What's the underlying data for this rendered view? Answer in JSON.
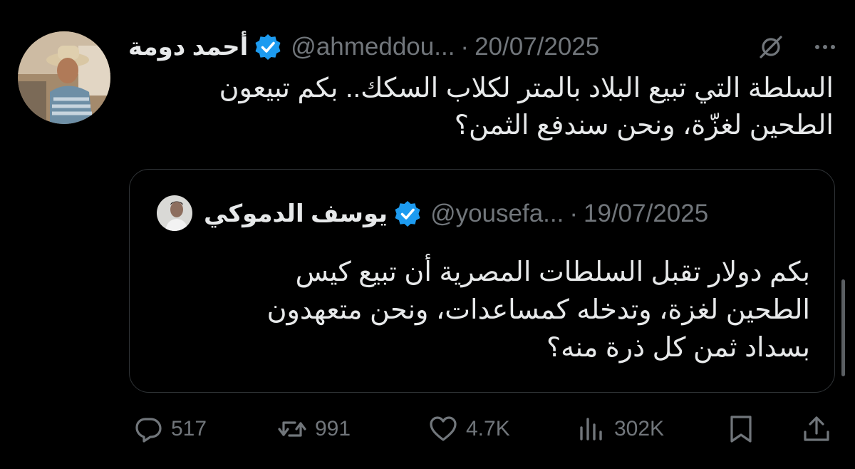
{
  "tweet": {
    "author_name": "أحمد دومة",
    "handle": "@ahmeddou...",
    "date": "20/07/2025",
    "separator": "·",
    "text": "السلطة التي تبيع البلاد بالمتر لكلاب السكك.. بكم تبيعون\nالطحين لغزّة، ونحن سندفع الثمن؟",
    "icons": {
      "verified": "verified-badge-icon",
      "grok": "grok-icon",
      "more": "more-options-icon"
    }
  },
  "quoted_tweet": {
    "author_name": "يوسف الدموكي",
    "handle": "@yousefa...",
    "date": "19/07/2025",
    "separator": "·",
    "text": "بكم دولار تقبل السلطات المصرية أن تبيع كيس\nالطحين لغزة، وتدخله كمساعدات، ونحن متعهدون\nبسداد ثمن كل ذرة منه؟"
  },
  "actions": {
    "replies": "517",
    "reposts": "991",
    "likes": "4.7K",
    "views": "302K"
  },
  "colors": {
    "background": "#000000",
    "text": "#e7e9ea",
    "secondary": "#71767b",
    "border": "#2f3336",
    "verified": "#1d9bf0"
  }
}
